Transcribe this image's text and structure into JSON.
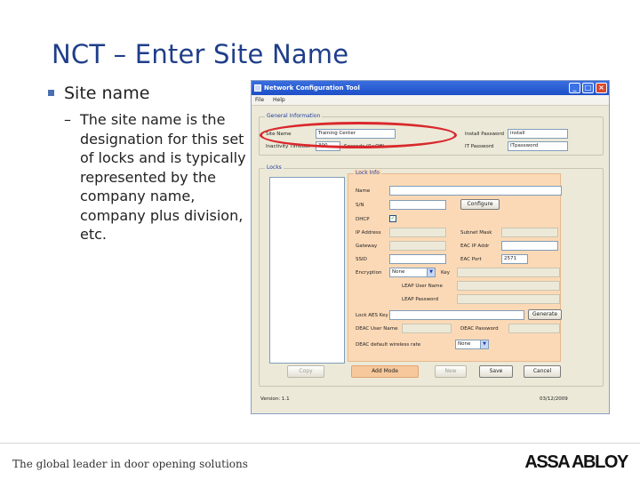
{
  "slide": {
    "title": "NCT – Enter Site Name",
    "bullet": "Site name",
    "sub_bullet": "The site name is the designation for this set of locks and is typically represented by the company name, company plus division, etc.",
    "footer_tagline": "The global leader in door opening solutions",
    "footer_logo": "ASSA ABLOY"
  },
  "window": {
    "title": "Network Configuration Tool",
    "menu": [
      "File",
      "Help"
    ],
    "general": {
      "label": "General Information",
      "site_name_label": "Site Name",
      "site_name_value": "Training Center",
      "inactivity_label": "Inactivity Timeout",
      "inactivity_value": "300",
      "seconds_label": "Seconds (0=Off)",
      "install_password_label": "Install Password",
      "install_password_value": "install",
      "it_password_label": "IT Password",
      "it_password_value": "ITpassword"
    },
    "locks_label": "Locks",
    "lockinfo": {
      "label": "Lock Info",
      "name_label": "Name",
      "sn_label": "S/N",
      "configure_button": "Configure",
      "dhcp_label": "DHCP",
      "dhcp_checked": "✓",
      "ip_label": "IP Address",
      "subnet_label": "Subnet Mask",
      "gateway_label": "Gateway",
      "eac_ip_label": "EAC IP Addr",
      "ssid_label": "SSID",
      "eac_port_label": "EAC Port",
      "eac_port_value": "2571",
      "encryption_label": "Encryption",
      "encryption_value": "None",
      "key_label": "Key",
      "leap_user_label": "LEAP User Name",
      "leap_password_label": "LEAP Password",
      "aes_key_label": "Lock AES Key",
      "generate_button": "Generate",
      "deac_user_label": "DEAC User Name",
      "deac_password_label": "DEAC Password",
      "deac_wireless_label": "DEAC default wireless rate",
      "deac_wireless_value": "None"
    },
    "buttons": {
      "copy": "Copy",
      "add_mode": "Add Mode",
      "new": "New",
      "save": "Save",
      "cancel": "Cancel"
    },
    "status": {
      "version": "Version: 1.1",
      "date": "03/12/2009"
    }
  },
  "colors": {
    "title_blue": "#1f3e8a",
    "highlight_red": "#d9282b",
    "lockinfo_bg": "#fcd9b6",
    "titlebar_blue": "#1d4fc8"
  }
}
